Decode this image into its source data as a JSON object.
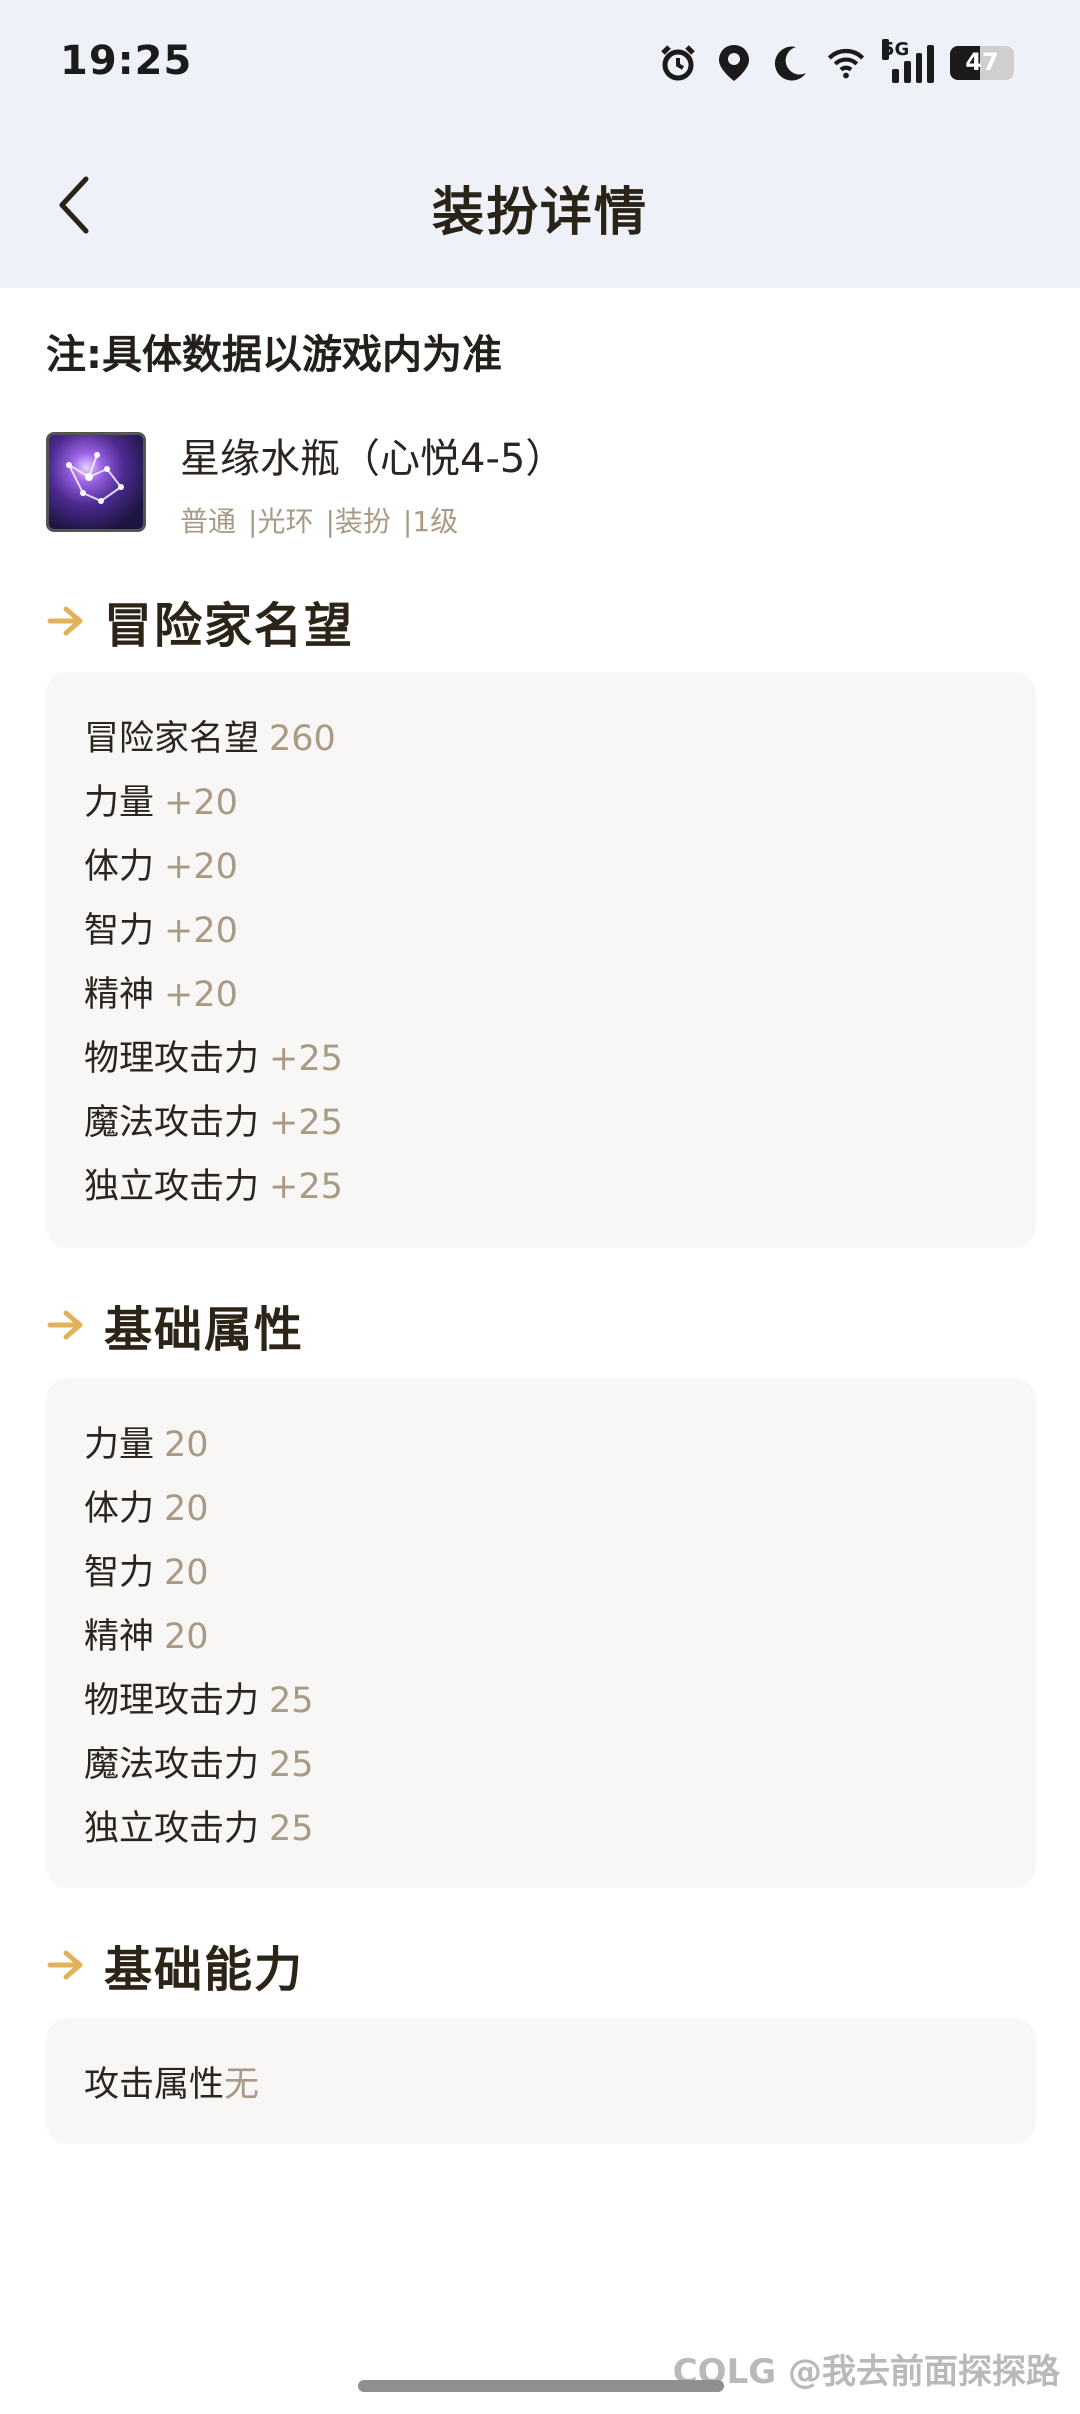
{
  "status_bar": {
    "time": "19:25",
    "network": "5G",
    "battery": "47",
    "icons": [
      "alarm-icon",
      "location-icon",
      "moon-icon",
      "wifi-icon",
      "signal-icon",
      "battery-icon"
    ]
  },
  "header": {
    "title": "装扮详情",
    "back_icon": "chevron-left-icon"
  },
  "note": "注:具体数据以游戏内为准",
  "item": {
    "name": "星缘水瓶（心悦4-5）",
    "tags": [
      "普通",
      "|光环",
      "|装扮",
      "|1级"
    ]
  },
  "sections": {
    "fame": {
      "title": "冒险家名望",
      "rows": [
        {
          "label": "冒险家名望",
          "value": "260"
        },
        {
          "label": "力量",
          "value": "+20"
        },
        {
          "label": "体力",
          "value": "+20"
        },
        {
          "label": "智力",
          "value": "+20"
        },
        {
          "label": "精神",
          "value": "+20"
        },
        {
          "label": "物理攻击力",
          "value": "+25"
        },
        {
          "label": "魔法攻击力",
          "value": "+25"
        },
        {
          "label": "独立攻击力",
          "value": "+25"
        }
      ]
    },
    "base_attr": {
      "title": "基础属性",
      "rows": [
        {
          "label": "力量",
          "value": "20"
        },
        {
          "label": "体力",
          "value": "20"
        },
        {
          "label": "智力",
          "value": "20"
        },
        {
          "label": "精神",
          "value": "20"
        },
        {
          "label": "物理攻击力",
          "value": "25"
        },
        {
          "label": "魔法攻击力",
          "value": "25"
        },
        {
          "label": "独立攻击力",
          "value": "25"
        }
      ]
    },
    "base_ability": {
      "title": "基础能力",
      "rows": [
        {
          "label": "攻击属性",
          "value": "无"
        }
      ]
    }
  },
  "watermark": "COLG @我去前面探探路",
  "colors": {
    "accent_arrow": "#e0b35a",
    "value_text": "#a89a84",
    "header_bg": "#eef1f7",
    "card_bg": "#f8f7f5"
  }
}
